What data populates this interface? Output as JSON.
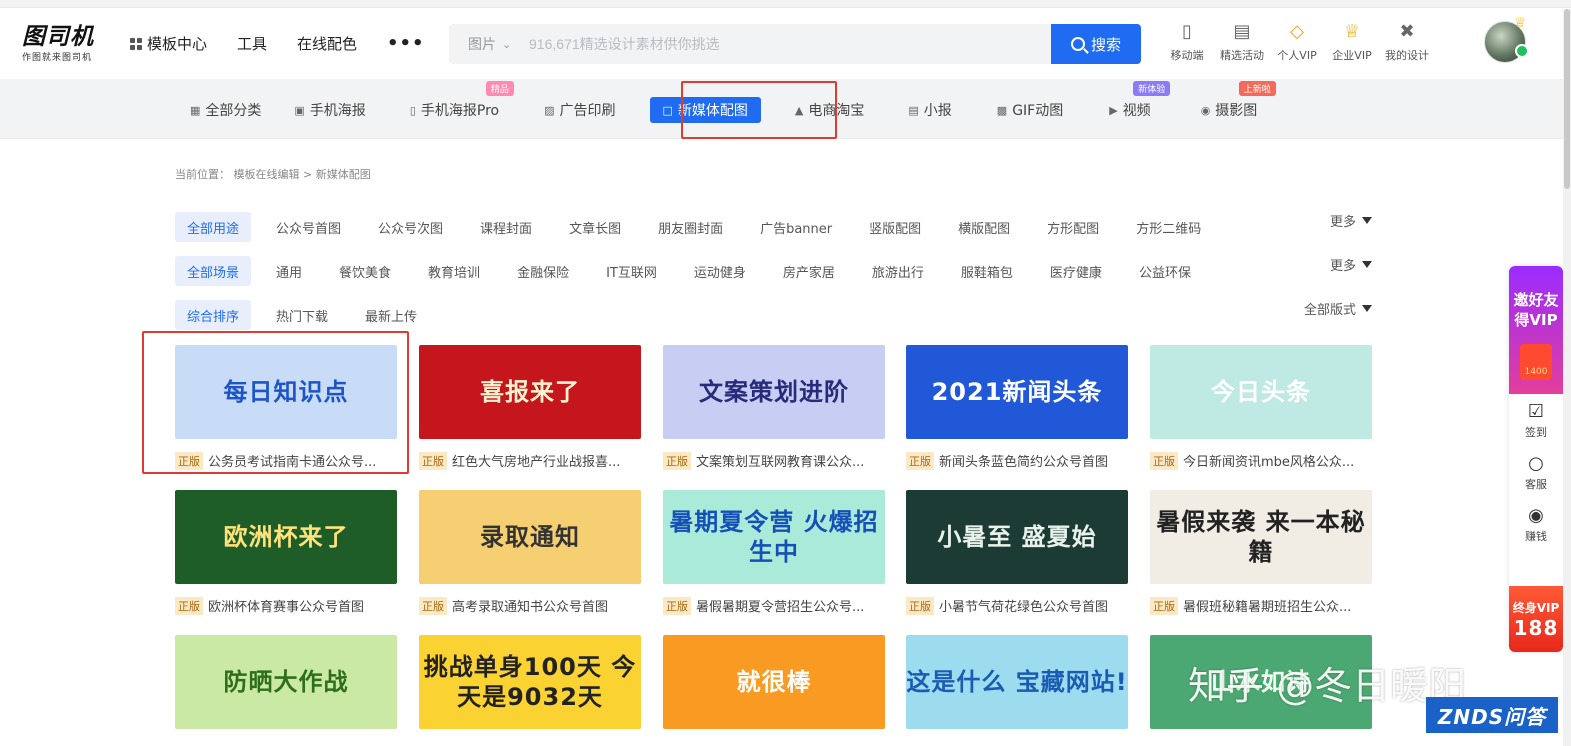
{
  "header": {
    "logo_main": "图司机",
    "logo_sub": "作图就来图司机",
    "nav": [
      {
        "label": "模板中心",
        "icon": "grid-icon"
      },
      {
        "label": "工具"
      },
      {
        "label": "在线配色"
      },
      {
        "label": "•••"
      }
    ],
    "search": {
      "category": "图片",
      "placeholder": "916,671精选设计素材供你挑选",
      "button": "搜索"
    },
    "tools": [
      {
        "label": "移动端",
        "icon": "mobile-icon"
      },
      {
        "label": "精选活动",
        "icon": "gift-icon"
      },
      {
        "label": "个人VIP",
        "icon": "diamond-icon"
      },
      {
        "label": "企业VIP",
        "icon": "crown-icon"
      },
      {
        "label": "我的设计",
        "icon": "tools-icon"
      }
    ]
  },
  "categories": [
    {
      "label": "全部分类",
      "icon": "grid-icon"
    },
    {
      "label": "手机海报",
      "icon": "image-icon"
    },
    {
      "label": "手机海报Pro",
      "icon": "phone-poster-icon",
      "tag": "精品"
    },
    {
      "label": "广告印刷",
      "icon": "ad-icon"
    },
    {
      "label": "新媒体配图",
      "icon": "document-icon",
      "active": true
    },
    {
      "label": "电商淘宝",
      "icon": "shop-icon"
    },
    {
      "label": "小报",
      "icon": "book-icon"
    },
    {
      "label": "GIF动图",
      "icon": "gif-icon"
    },
    {
      "label": "视频",
      "icon": "video-icon",
      "tag": "新体验"
    },
    {
      "label": "摄影图",
      "icon": "camera-icon",
      "tag": "上新啦"
    }
  ],
  "breadcrumb": {
    "prefix": "当前位置：",
    "path": "模板在线编辑 > 新媒体配图"
  },
  "filters": {
    "usage": [
      "全部用途",
      "公众号首图",
      "公众号次图",
      "课程封面",
      "文章长图",
      "朋友圈封面",
      "广告banner",
      "竖版配图",
      "横版配图",
      "方形配图",
      "方形二维码"
    ],
    "scene": [
      "全部场景",
      "通用",
      "餐饮美食",
      "教育培训",
      "金融保险",
      "IT互联网",
      "运动健身",
      "房产家居",
      "旅游出行",
      "服鞋箱包",
      "医疗健康",
      "公益环保"
    ],
    "sort": [
      "综合排序",
      "热门下载",
      "最新上传"
    ],
    "more": "更多",
    "all_formats": "全部版式"
  },
  "cards": [
    {
      "title": "公务员考试指南卡通公众号...",
      "thumb": "每日知识点",
      "badge": "正版",
      "bg": "#c9dcf7",
      "fg": "#1d55c8"
    },
    {
      "title": "红色大气房地产行业战报喜...",
      "thumb": "喜报来了",
      "badge": "正版",
      "bg": "#c4161c",
      "fg": "#fff3d0"
    },
    {
      "title": "文案策划互联网教育课公众...",
      "thumb": "文案策划进阶",
      "badge": "正版",
      "bg": "#c8cdf3",
      "fg": "#272c7a"
    },
    {
      "title": "新闻头条蓝色简约公众号首图",
      "thumb": "2021新闻头条",
      "badge": "正版",
      "bg": "#2158d8",
      "fg": "#ffffff"
    },
    {
      "title": "今日新闻资讯mbe风格公众...",
      "thumb": "今日头条",
      "badge": "正版",
      "bg": "#bfeae4",
      "fg": "#ffffff"
    },
    {
      "title": "欧洲杯体育赛事公众号首图",
      "thumb": "欧洲杯来了",
      "badge": "正版",
      "bg": "#1f5d28",
      "fg": "#ffe27a"
    },
    {
      "title": "高考录取通知书公众号首图",
      "thumb": "录取通知",
      "badge": "正版",
      "bg": "#f7cf73",
      "fg": "#333333"
    },
    {
      "title": "暑假暑期夏令营招生公众号...",
      "thumb": "暑期夏令营 火爆招生中",
      "badge": "正版",
      "bg": "#a9ead9",
      "fg": "#1550b8"
    },
    {
      "title": "小暑节气荷花绿色公众号首图",
      "thumb": "小暑至 盛夏始",
      "badge": "正版",
      "bg": "#1c3b34",
      "fg": "#e8f2ea"
    },
    {
      "title": "暑假班秘籍暑期班招生公众...",
      "thumb": "暑假来袭 来一本秘籍",
      "badge": "正版",
      "bg": "#f1ede5",
      "fg": "#222222"
    },
    {
      "title": "",
      "thumb": "防晒大作战",
      "badge": "",
      "bg": "#c9e9a5",
      "fg": "#2f6e1b"
    },
    {
      "title": "",
      "thumb": "挑战单身100天 今天是9032天",
      "badge": "",
      "bg": "#fad232",
      "fg": "#222222"
    },
    {
      "title": "",
      "thumb": "就很棒",
      "badge": "",
      "bg": "#f99a22",
      "fg": "#ffffff"
    },
    {
      "title": "",
      "thumb": "这是什么 宝藏网站!",
      "badge": "",
      "bg": "#9ddcef",
      "fg": "#1a5bb3"
    },
    {
      "title": "",
      "thumb": "山水如诗",
      "badge": "",
      "bg": "#4ca872",
      "fg": "#f4fff4"
    }
  ],
  "sidebar": {
    "invite_line1": "邀好友",
    "invite_line2": "得VIP",
    "invite_amount": "1400",
    "items": [
      {
        "label": "签到",
        "icon": "calendar-icon"
      },
      {
        "label": "客服",
        "icon": "chat-icon"
      },
      {
        "label": "赚钱",
        "icon": "coin-icon"
      }
    ],
    "vip_line1": "终身VIP",
    "vip_price": "188"
  },
  "watermark": {
    "text": "知乎 @冬日暖阳",
    "badge": "ZNDS问答"
  },
  "colors": {
    "accent": "#1f6cf2",
    "highlight_box": "#e03b32"
  }
}
